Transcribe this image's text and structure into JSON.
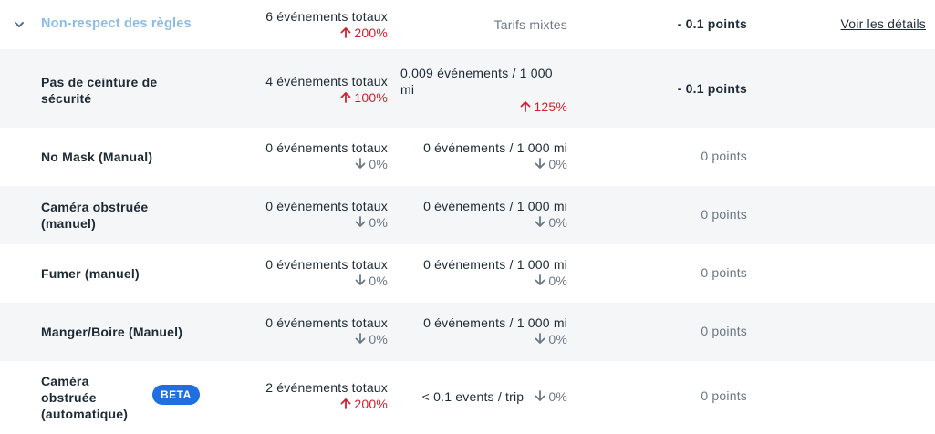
{
  "group": {
    "label": "Non-respect des règles",
    "total": "6 événements totaux",
    "total_change": "200%",
    "rate": "Tarifs mixtes",
    "points": "- 0.1 points",
    "details_link": "Voir les détails"
  },
  "rows": [
    {
      "name_line1": "Pas de ceinture de",
      "name_line2": "sécurité",
      "total": "4 événements totaux",
      "total_change": "100%",
      "rate_line1": "0.009 événements / 1 000",
      "rate_line2": "mi",
      "rate_change": "125%",
      "points": "- 0.1 points"
    },
    {
      "name_line1": "No Mask (Manual)",
      "total": "0 événements totaux",
      "total_change": "0%",
      "rate_line1": "0 événements / 1 000 mi",
      "rate_change": "0%",
      "points": "0 points"
    },
    {
      "name_line1": "Caméra obstruée",
      "name_line2": "(manuel)",
      "total": "0 événements totaux",
      "total_change": "0%",
      "rate_line1": "0 événements / 1 000 mi",
      "rate_change": "0%",
      "points": "0 points"
    },
    {
      "name_line1": "Fumer (manuel)",
      "total": "0 événements totaux",
      "total_change": "0%",
      "rate_line1": "0 événements / 1 000 mi",
      "rate_change": "0%",
      "points": "0 points"
    },
    {
      "name_line1": "Manger/Boire (Manuel)",
      "total": "0 événements totaux",
      "total_change": "0%",
      "rate_line1": "0 événements / 1 000 mi",
      "rate_change": "0%",
      "points": "0 points"
    },
    {
      "name_line1": "Caméra",
      "name_line2": "obstruée",
      "name_line3": "(automatique)",
      "badge": "BETA",
      "total": "2 événements totaux",
      "total_change": "200%",
      "rate_line1": "< 0.1 events / trip",
      "rate_change": "0%",
      "points": "0 points"
    }
  ],
  "colors": {
    "group_label": "#8bbce6",
    "increase": "#d1212e",
    "neutral": "#6b7884",
    "beta_badge": "#1f6fe0",
    "alt_row": "#f4f6f8"
  },
  "icons": {
    "expand": "chevron-down-icon",
    "increase": "arrow-up-icon",
    "decrease": "arrow-down-icon"
  }
}
